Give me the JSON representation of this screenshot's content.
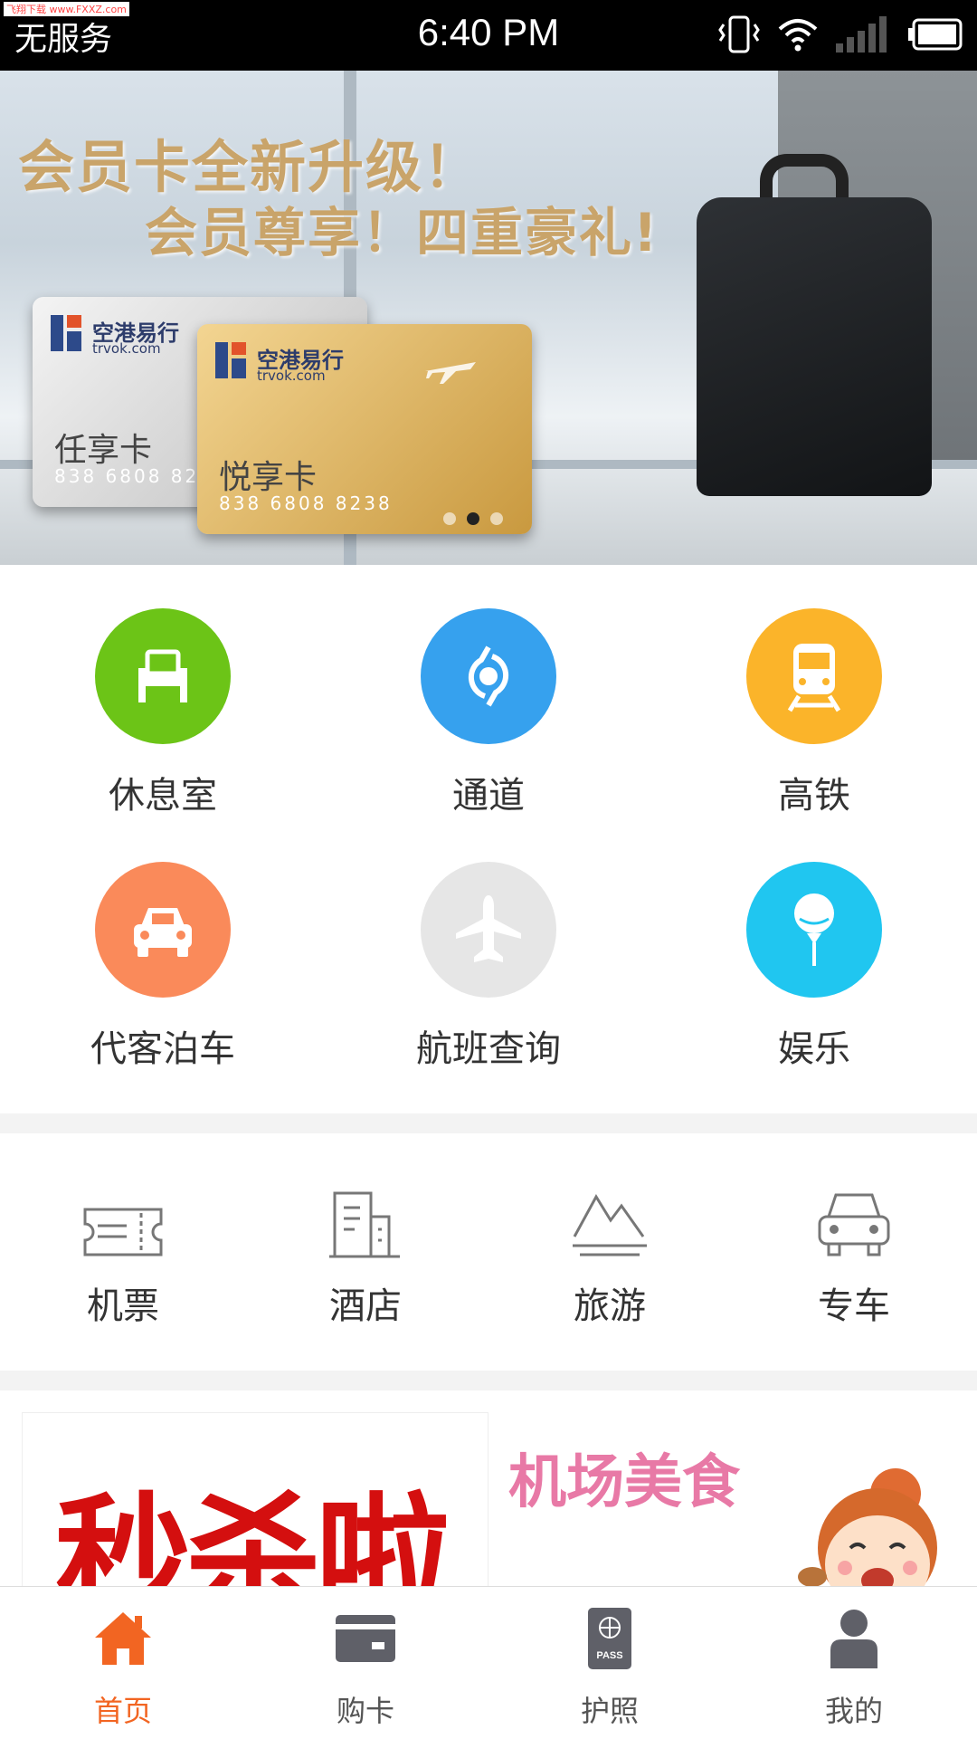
{
  "status_bar": {
    "watermark": "飞翔下载 www.FXXZ.com",
    "carrier": "无服务",
    "time": "6:40 PM",
    "icons": [
      "vibrate-icon",
      "wifi-icon",
      "signal-icon",
      "battery-icon"
    ]
  },
  "banner": {
    "headline_1": "会员卡全新升级！",
    "headline_2": "会员尊享！四重豪礼!",
    "cards": [
      {
        "brand": "空港易行",
        "site": "trvok.com",
        "name": "任享卡",
        "number": "838 6808 82"
      },
      {
        "brand": "空港易行",
        "site": "trvok.com",
        "name": "悦享卡",
        "number": "838 6808 8238"
      }
    ],
    "carousel": {
      "count": 3,
      "active_index": 1
    }
  },
  "services": [
    {
      "label": "休息室",
      "icon": "armchair-icon",
      "color": "#6cc417"
    },
    {
      "label": "通道",
      "icon": "gate-icon",
      "color": "#36a1ee"
    },
    {
      "label": "高铁",
      "icon": "train-icon",
      "color": "#fbb42a"
    },
    {
      "label": "代客泊车",
      "icon": "car-icon",
      "color": "#fa8a5a"
    },
    {
      "label": "航班查询",
      "icon": "plane-icon",
      "color": "#e6e6e6"
    },
    {
      "label": "娱乐",
      "icon": "lollipop-icon",
      "color": "#20c6f0"
    }
  ],
  "travel": [
    {
      "label": "机票",
      "icon": "ticket-icon"
    },
    {
      "label": "酒店",
      "icon": "building-icon"
    },
    {
      "label": "旅游",
      "icon": "mountain-icon"
    },
    {
      "label": "专车",
      "icon": "car-outline-icon"
    }
  ],
  "promos": {
    "left_text": "秒杀啦",
    "right_title": "机场美食"
  },
  "tabbar": {
    "tabs": [
      {
        "label": "首页",
        "icon": "home-icon",
        "active": true
      },
      {
        "label": "购卡",
        "icon": "card-icon",
        "active": false
      },
      {
        "label": "护照",
        "icon": "passport-icon",
        "active": false
      },
      {
        "label": "我的",
        "icon": "user-icon",
        "active": false
      }
    ],
    "passport_badge": "PASS"
  },
  "colors": {
    "accent": "#f26522",
    "tab_icon": "#5f6068"
  }
}
